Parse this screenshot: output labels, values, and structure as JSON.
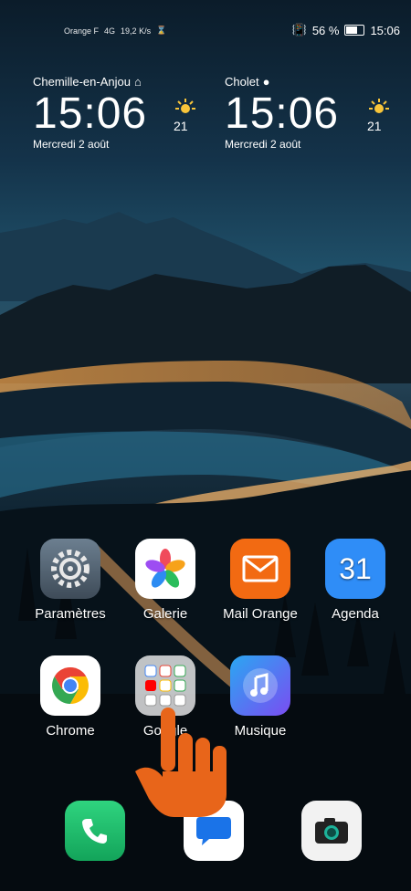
{
  "status": {
    "carrier": "Orange F",
    "network": "4G",
    "speed": "19,2 K/s",
    "battery_pct": "56 %",
    "battery_level": 0.56,
    "time": "15:06"
  },
  "clock1": {
    "city": "Chemille-en-Anjou",
    "time": "15:06",
    "date": "Mercredi 2 août",
    "temp": "21"
  },
  "clock2": {
    "city": "Cholet",
    "time": "15:06",
    "date": "Mercredi 2 août",
    "temp": "21"
  },
  "apps": {
    "parametres": "Paramètres",
    "galerie": "Galerie",
    "mail": "Mail Orange",
    "agenda": "Agenda",
    "agenda_day": "31",
    "chrome": "Chrome",
    "google": "Google",
    "musique": "Musique"
  },
  "dock": [
    "Téléphone",
    "Messages",
    "Appareil photo"
  ],
  "colors": {
    "mail": "#f26a12",
    "agenda": "#2f8df7",
    "phone": "#1bbf6f",
    "hand": "#e8651a"
  }
}
